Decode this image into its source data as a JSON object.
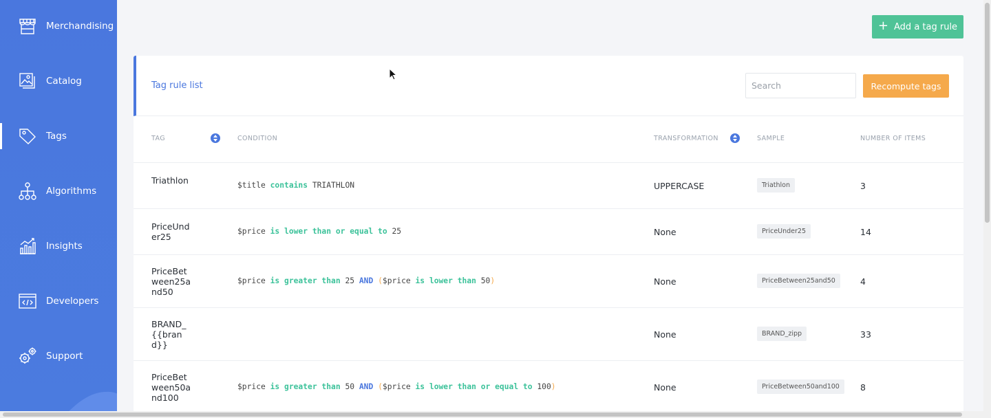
{
  "sidebar": {
    "items": [
      {
        "label": "Merchandising",
        "icon": "storefront-icon"
      },
      {
        "label": "Catalog",
        "icon": "images-icon"
      },
      {
        "label": "Tags",
        "icon": "tag-icon",
        "active": true
      },
      {
        "label": "Algorithms",
        "icon": "hierarchy-icon"
      },
      {
        "label": "Insights",
        "icon": "chart-icon"
      },
      {
        "label": "Developers",
        "icon": "code-icon"
      },
      {
        "label": "Support",
        "icon": "gears-icon"
      }
    ]
  },
  "header": {
    "add_button_label": "Add a tag rule"
  },
  "card": {
    "title": "Tag rule list",
    "search_placeholder": "Search",
    "recompute_label": "Recompute tags"
  },
  "table": {
    "headers": {
      "tag": "TAG",
      "condition": "CONDITION",
      "transformation": "TRANSFORMATION",
      "sample": "SAMPLE",
      "count": "NUMBER OF ITEMS"
    },
    "rows": [
      {
        "tag": "Triathlon",
        "condition": [
          {
            "t": "$title ",
            "c": ""
          },
          {
            "t": "contains",
            "c": "kw"
          },
          {
            "t": " TRIATHLON",
            "c": ""
          }
        ],
        "transformation": "UPPERCASE",
        "sample": "Triathlon",
        "count": "3"
      },
      {
        "tag": "PriceUnder25",
        "condition": [
          {
            "t": "$price ",
            "c": ""
          },
          {
            "t": "is lower than or equal to",
            "c": "kw"
          },
          {
            "t": " 25",
            "c": ""
          }
        ],
        "transformation": "None",
        "sample": "PriceUnder25",
        "count": "14"
      },
      {
        "tag": "PriceBetween25and50",
        "condition": [
          {
            "t": "$price ",
            "c": ""
          },
          {
            "t": "is greater than",
            "c": "kw"
          },
          {
            "t": " 25 ",
            "c": ""
          },
          {
            "t": "AND",
            "c": "op"
          },
          {
            "t": " ",
            "c": ""
          },
          {
            "t": "(",
            "c": "paren"
          },
          {
            "t": "$price ",
            "c": ""
          },
          {
            "t": "is lower than",
            "c": "kw"
          },
          {
            "t": " 50",
            "c": ""
          },
          {
            "t": ")",
            "c": "paren"
          }
        ],
        "transformation": "None",
        "sample": "PriceBetween25and50",
        "count": "4"
      },
      {
        "tag": "BRAND_{{brand}}",
        "condition": [],
        "transformation": "None",
        "sample": "BRAND_zipp",
        "count": "33"
      },
      {
        "tag": "PriceBetween50and100",
        "condition": [
          {
            "t": "$price ",
            "c": ""
          },
          {
            "t": "is greater than",
            "c": "kw"
          },
          {
            "t": " 50 ",
            "c": ""
          },
          {
            "t": "AND",
            "c": "op"
          },
          {
            "t": " ",
            "c": ""
          },
          {
            "t": "(",
            "c": "paren"
          },
          {
            "t": "$price ",
            "c": ""
          },
          {
            "t": "is lower than or equal to",
            "c": "kw"
          },
          {
            "t": " 100",
            "c": ""
          },
          {
            "t": ")",
            "c": "paren"
          }
        ],
        "transformation": "None",
        "sample": "PriceBetween50and100",
        "count": "8"
      }
    ]
  },
  "colors": {
    "sidebar": "#4a77de",
    "add_button": "#4fc397",
    "recompute_button": "#f5a94b",
    "keyword": "#3cc29a",
    "operator": "#4a77de"
  }
}
